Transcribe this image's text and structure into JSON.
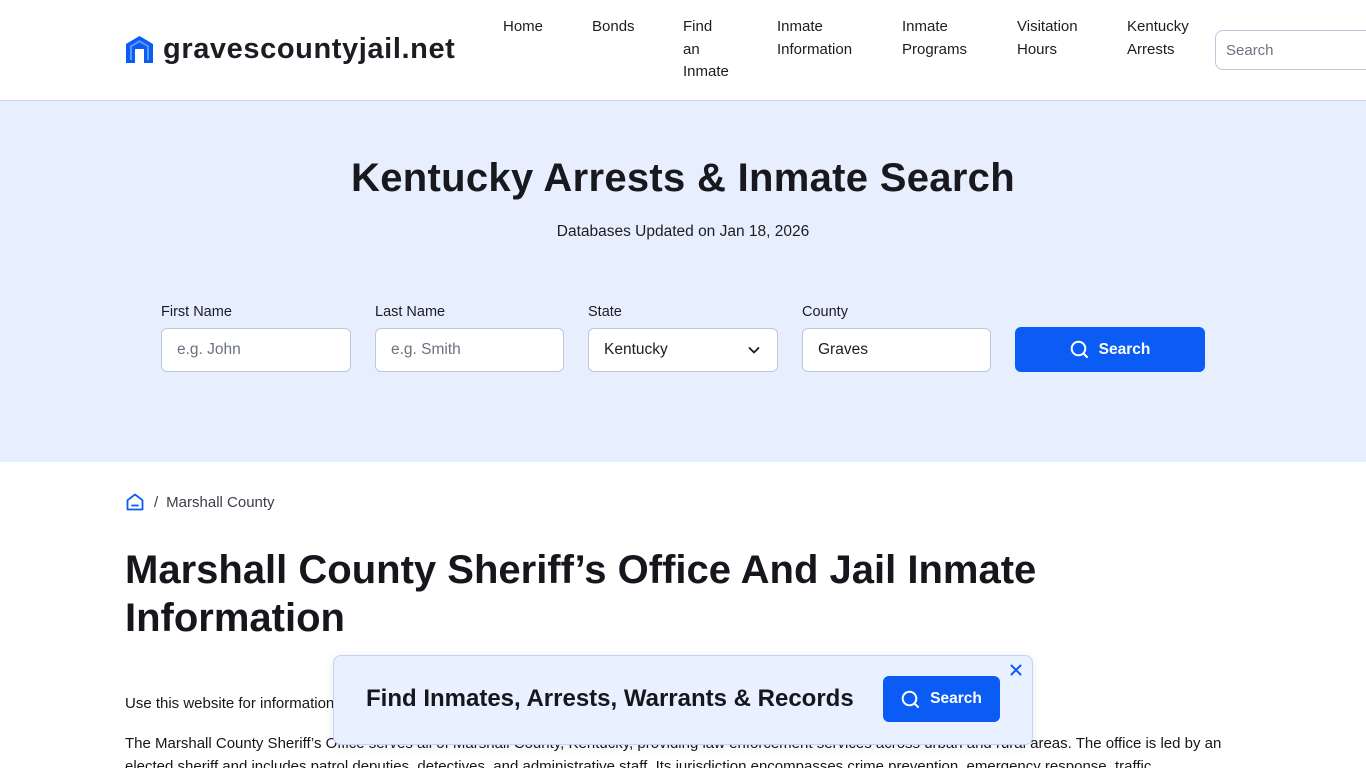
{
  "brand": {
    "logo_text": "gravescountyjail.net",
    "accent_color": "#0a5cf5",
    "hero_bg_color": "#e7efff"
  },
  "header": {
    "nav": [
      {
        "label": "Home"
      },
      {
        "label": "Bonds"
      },
      {
        "label": "Find an Inmate"
      },
      {
        "label": "Inmate Information"
      },
      {
        "label": "Inmate Programs"
      },
      {
        "label": "Visitation Hours"
      },
      {
        "label": "Kentucky Arrests"
      }
    ],
    "search_placeholder": "Search"
  },
  "hero": {
    "title": "Kentucky Arrests & Inmate Search",
    "subtitle": "Databases Updated on Jan 18, 2026",
    "form": {
      "first_name_label": "First Name",
      "first_name_placeholder": "e.g. John",
      "last_name_label": "Last Name",
      "last_name_placeholder": "e.g. Smith",
      "state_label": "State",
      "state_value": "Kentucky",
      "county_label": "County",
      "county_value": "Graves",
      "search_button": "Search"
    }
  },
  "breadcrumb": {
    "home_icon": "home-icon",
    "current": "Marshall County"
  },
  "article": {
    "title": "Marshall County Sheriff’s Office And Jail Inmate Information",
    "intro": "Use this website for information",
    "paragraph": "The Marshall County Sheriff’s Office serves all of Marshall County, Kentucky, providing law enforcement services across urban and rural areas. The office is led by an elected sheriff and includes patrol deputies, detectives, and administrative staff. Its jurisdiction encompasses crime prevention, emergency response, traffic"
  },
  "popup": {
    "title": "Find Inmates, Arrests, Warrants & Records",
    "button": "Search",
    "close_icon": "close-icon"
  }
}
